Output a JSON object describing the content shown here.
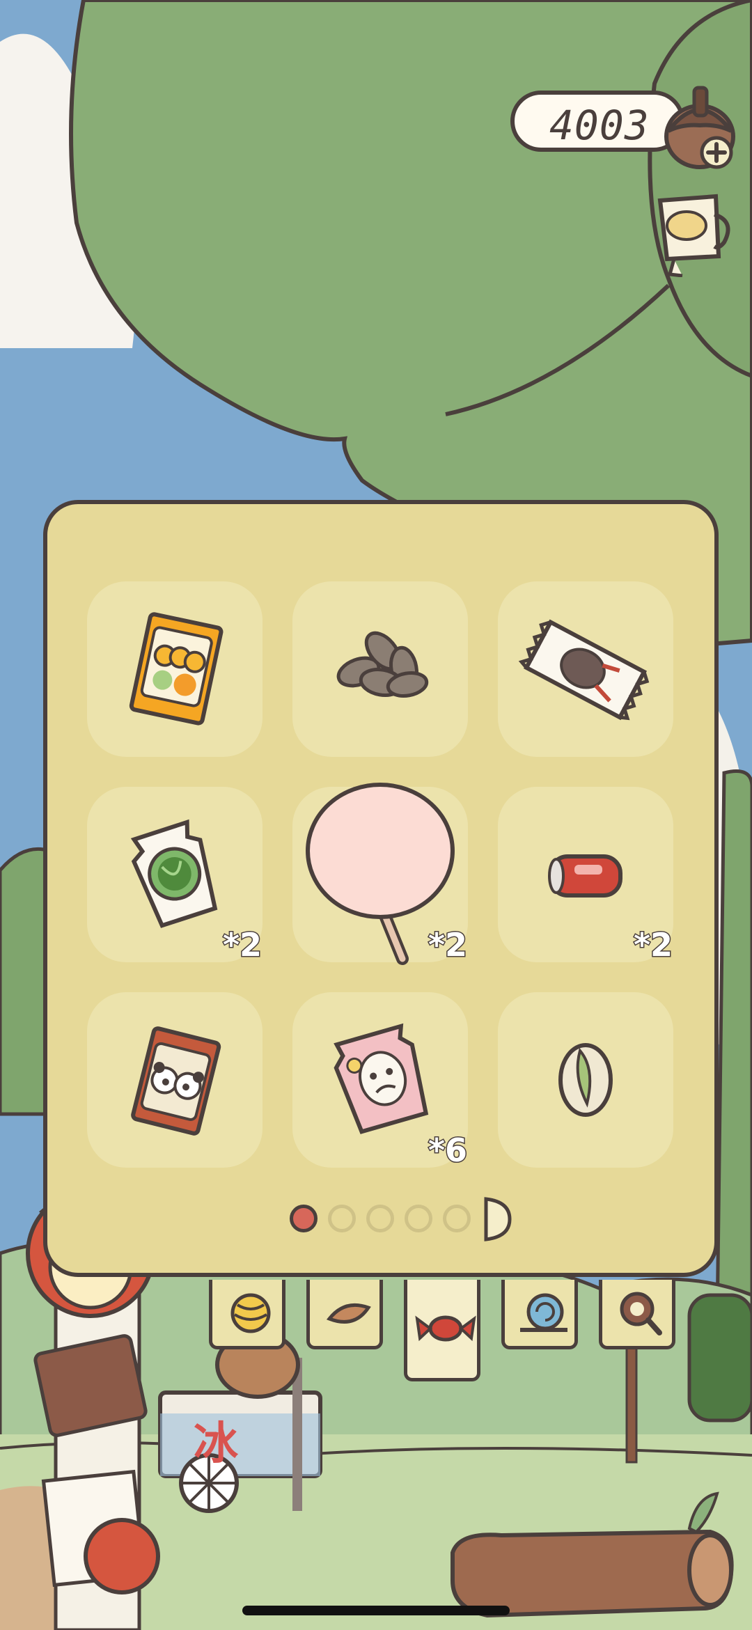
{
  "hud": {
    "coins": "4003",
    "coin_icon": "acorn-icon",
    "add_icon": "plus-icon",
    "side_button_icon": "cup-icon"
  },
  "inventory": {
    "items": [
      {
        "name": "orange-snack-bag",
        "count": ""
      },
      {
        "name": "sunflower-seeds",
        "count": ""
      },
      {
        "name": "chocolate-candy-wrapper",
        "count": ""
      },
      {
        "name": "watermelon-candy",
        "count": "*2"
      },
      {
        "name": "pink-cotton-candy",
        "count": "*2"
      },
      {
        "name": "soda-can",
        "count": "*2"
      },
      {
        "name": "panda-snack-bag",
        "count": ""
      },
      {
        "name": "pink-candy-wrapper",
        "count": "*6"
      },
      {
        "name": "pistachio",
        "count": ""
      }
    ],
    "pages": 5,
    "current_page": 1
  },
  "tabs": [
    {
      "icon": "yarn-ball-icon",
      "active": false
    },
    {
      "icon": "leaf-icon",
      "active": false
    },
    {
      "icon": "candy-icon",
      "active": true
    },
    {
      "icon": "snail-icon",
      "active": false
    },
    {
      "icon": "magnifier-icon",
      "active": false
    }
  ],
  "scene": {
    "shop_sign": "冰"
  },
  "colors": {
    "panel": "#e6d998",
    "slot": "#ece3ac",
    "outline": "#4a3f3c",
    "tree": "#89ad76",
    "sky": "#7ea9cf",
    "dot_active": "#d7675a"
  }
}
